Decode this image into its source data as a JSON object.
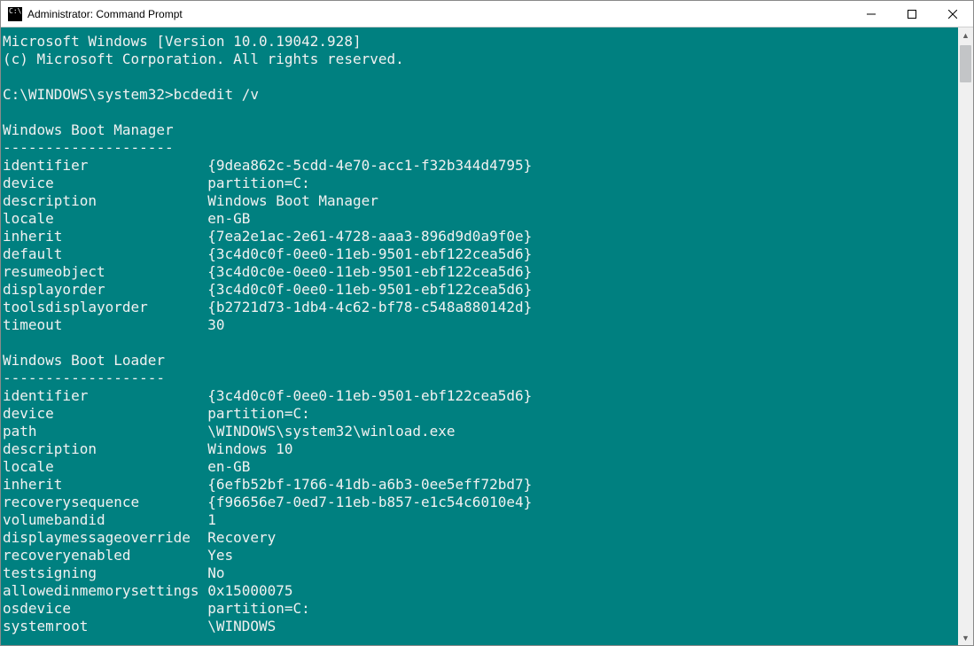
{
  "window": {
    "title": "Administrator: Command Prompt"
  },
  "terminal": {
    "header_line1": "Microsoft Windows [Version 10.0.19042.928]",
    "header_line2": "(c) Microsoft Corporation. All rights reserved.",
    "prompt_path": "C:\\WINDOWS\\system32>",
    "command": "bcdedit /v",
    "sections": [
      {
        "title": "Windows Boot Manager",
        "divider": "--------------------",
        "rows": [
          {
            "key": "identifier",
            "value": "{9dea862c-5cdd-4e70-acc1-f32b344d4795}"
          },
          {
            "key": "device",
            "value": "partition=C:"
          },
          {
            "key": "description",
            "value": "Windows Boot Manager"
          },
          {
            "key": "locale",
            "value": "en-GB"
          },
          {
            "key": "inherit",
            "value": "{7ea2e1ac-2e61-4728-aaa3-896d9d0a9f0e}"
          },
          {
            "key": "default",
            "value": "{3c4d0c0f-0ee0-11eb-9501-ebf122cea5d6}"
          },
          {
            "key": "resumeobject",
            "value": "{3c4d0c0e-0ee0-11eb-9501-ebf122cea5d6}"
          },
          {
            "key": "displayorder",
            "value": "{3c4d0c0f-0ee0-11eb-9501-ebf122cea5d6}"
          },
          {
            "key": "toolsdisplayorder",
            "value": "{b2721d73-1db4-4c62-bf78-c548a880142d}"
          },
          {
            "key": "timeout",
            "value": "30"
          }
        ]
      },
      {
        "title": "Windows Boot Loader",
        "divider": "-------------------",
        "rows": [
          {
            "key": "identifier",
            "value": "{3c4d0c0f-0ee0-11eb-9501-ebf122cea5d6}"
          },
          {
            "key": "device",
            "value": "partition=C:"
          },
          {
            "key": "path",
            "value": "\\WINDOWS\\system32\\winload.exe"
          },
          {
            "key": "description",
            "value": "Windows 10"
          },
          {
            "key": "locale",
            "value": "en-GB"
          },
          {
            "key": "inherit",
            "value": "{6efb52bf-1766-41db-a6b3-0ee5eff72bd7}"
          },
          {
            "key": "recoverysequence",
            "value": "{f96656e7-0ed7-11eb-b857-e1c54c6010e4}"
          },
          {
            "key": "volumebandid",
            "value": "1"
          },
          {
            "key": "displaymessageoverride",
            "value": "Recovery"
          },
          {
            "key": "recoveryenabled",
            "value": "Yes"
          },
          {
            "key": "testsigning",
            "value": "No"
          },
          {
            "key": "allowedinmemorysettings",
            "value": "0x15000075"
          },
          {
            "key": "osdevice",
            "value": "partition=C:"
          },
          {
            "key": "systemroot",
            "value": "\\WINDOWS"
          }
        ]
      }
    ],
    "key_col_width": 24
  }
}
